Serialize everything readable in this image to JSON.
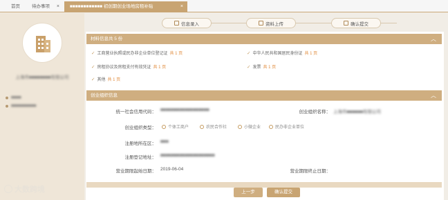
{
  "tabs": {
    "home": "首页",
    "todo": "待办事项",
    "active_blurred": "■■■■■■■■■■■■ 初创期创业场地房租补贴"
  },
  "profile": {
    "company_blurred": "上海市■■■■■■■■有限公司",
    "info1": "■■■■",
    "info2": "■■■■■■■■■■"
  },
  "logo": "大数跨境",
  "steps": [
    "信息录入",
    "资料上传",
    "确认提交"
  ],
  "materials": {
    "header": "材料信息共 5 份",
    "items": [
      {
        "name": "工商营业执照或民办非企业单位登记证",
        "count": "共 1 页"
      },
      {
        "name": "中华人民共和国居民身份证",
        "count": "共 1 页"
      },
      {
        "name": "房租协议及房租支付有效凭证",
        "count": "共 1 页"
      },
      {
        "name": "发票",
        "count": "共 1 页"
      },
      {
        "name": "其他",
        "count": "共 1 页"
      }
    ]
  },
  "org": {
    "header": "创业组织信息",
    "credit_code_label": "统一社会信用代码：",
    "credit_code_value": "■■■■■■■■■■■■■■■■■■",
    "org_name_label": "创业组织名称：",
    "org_name_value": "上海市■■■■■■有限公司",
    "type_label": "创业组织类型：",
    "type_options": [
      "个体工商户",
      "农民合作社",
      "小微企业",
      "民办非企业单位"
    ],
    "reg_area_label": "注册地所在区：",
    "reg_area_value": "■■■",
    "reg_addr_label": "注册登记地址：",
    "reg_addr_value": "■■■■■■■■■■■■■■■■■■■■",
    "start_label": "营业期限起始日期：",
    "start_value": "2019-06-04",
    "end_label": "营业期限终止日期："
  },
  "buttons": {
    "prev": "上一步",
    "submit": "确认提交"
  },
  "colors": {
    "accent": "#c8a472",
    "section": "#cfae80",
    "count": "#e08a3a"
  }
}
